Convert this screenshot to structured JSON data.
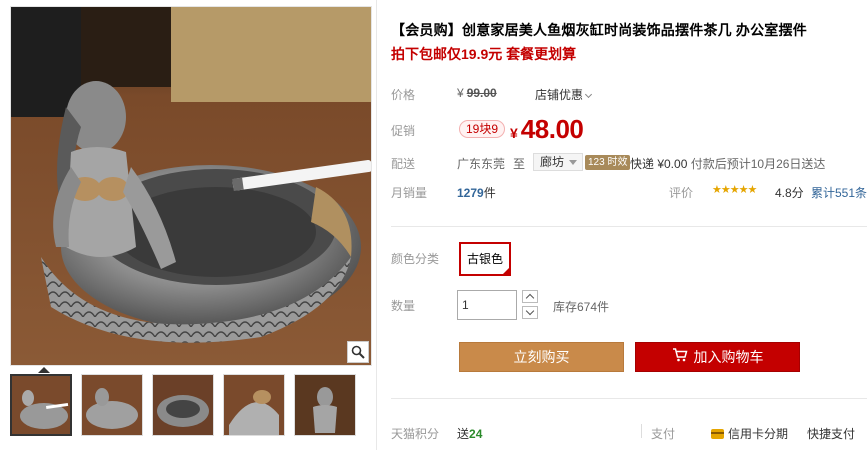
{
  "product": {
    "title": "【会员购】创意家居美人鱼烟灰缸时尚装饰品摆件茶几 办公室摆件",
    "promo_text": "拍下包邮仅19.9元 套餐更划算"
  },
  "price": {
    "label": "价格",
    "currency": "¥",
    "original": "99.00",
    "shop_discount": "店铺优惠"
  },
  "promotion": {
    "label": "促销",
    "badge": "19块9",
    "currency": "¥",
    "price": "48.00"
  },
  "shipping": {
    "label": "配送",
    "from": "广东东莞",
    "to_word": "至",
    "city": "廊坊",
    "badge": "123 时效",
    "method": "快递 ¥0.00",
    "estimate": "付款后预计10月26日送达"
  },
  "sales": {
    "label": "月销量",
    "count": "1279",
    "unit": "件",
    "review_label": "评价",
    "stars": "★★★★★",
    "score": "4.8分",
    "total_reviews": "累计551条"
  },
  "sku": {
    "color_label": "颜色分类",
    "selected": "古银色"
  },
  "quantity": {
    "label": "数量",
    "value": "1",
    "stock": "库存674件"
  },
  "actions": {
    "buy_now": "立刻购买",
    "add_to_cart": "加入购物车"
  },
  "footer": {
    "points_label": "天猫积分",
    "points_prefix": "送",
    "points_value": "24",
    "pay_label": "支付",
    "credit_installment": "信用卡分期",
    "quick_pay": "快捷支付"
  },
  "colors": {
    "accent_red": "#c40000",
    "buy_button": "#c98a4a",
    "link_blue": "#336699",
    "star_gold": "#e5a500"
  },
  "icons": {
    "zoom": "magnifier-icon",
    "cart": "shopping-cart-icon",
    "card": "credit-card-icon",
    "main_image": "mermaid-ashtray-photo"
  }
}
